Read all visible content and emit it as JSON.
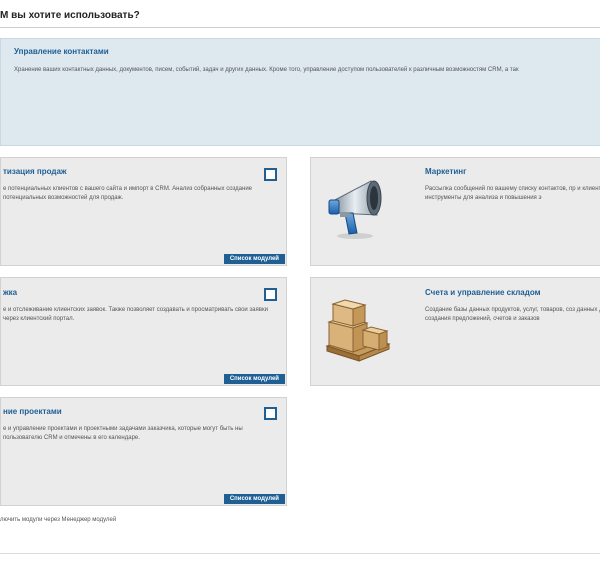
{
  "page": {
    "title": "М вы хотите использовать?",
    "footer": "лючить модули через Менеджер модулей"
  },
  "colors": {
    "accent": "#1f5f94",
    "box_bg": "#ebebeb",
    "highlight_bg": "#dde8ef"
  },
  "contacts_box": {
    "title": "Управление контактами",
    "description": "Хранение ваших контактных данных, документов, писем, событий, задач и других данных. Кроме того, управление доступом пользователей к различным возможностям CRM, а так"
  },
  "modules": [
    {
      "title": "тизация продаж",
      "description": "е потенциальных клиентов с вашего сайта и импорт в CRM. Анализ собранных  создание потенциальных возможностей для продаж.",
      "button": "Список модулей"
    },
    {
      "title": "Маркетинг",
      "description": "Рассылка сообщений по вашему списку контактов, пр и клиентов, инструменты для анализа и повышения э",
      "icon": "megaphone-icon"
    },
    {
      "title": "жка",
      "description": "е и отслеживание клиентских заявок. Также позволяет создавать и просматривать  свои заявки через клиентский портал.",
      "button": "Список модулей"
    },
    {
      "title": "Счета и управление складом",
      "description": "Создание базы данных продуктов, услуг, товаров, соз данных для создания предложений, счетов и заказов",
      "icon": "warehouse-boxes-icon"
    },
    {
      "title": "ние проектами",
      "description": "е и управление проектами и проектными задачами заказчика, которые могут быть ны пользователю CRM и отмечены в его календаре.",
      "button": "Список модулей"
    }
  ]
}
